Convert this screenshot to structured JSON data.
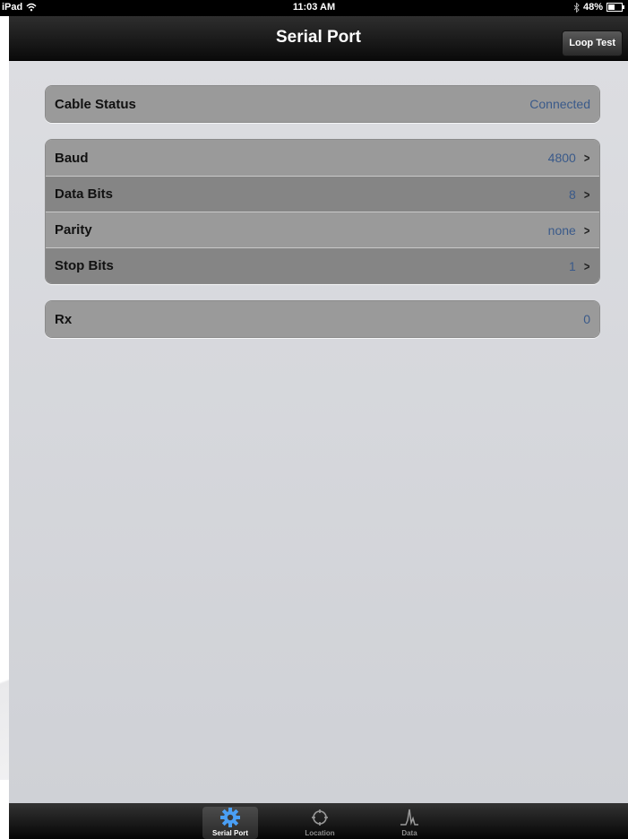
{
  "status_bar": {
    "device": "iPad",
    "time": "11:03 AM",
    "battery": "48%",
    "battery_level": 0.48
  },
  "nav": {
    "title": "Serial Port",
    "loop_test_label": "Loop Test"
  },
  "groups": [
    {
      "rows": [
        {
          "label": "Cable Status",
          "value": "Connected",
          "chevron": false
        }
      ]
    },
    {
      "rows": [
        {
          "label": "Baud",
          "value": "4800",
          "chevron": true
        },
        {
          "label": "Data Bits",
          "value": "8",
          "chevron": true
        },
        {
          "label": "Parity",
          "value": "none",
          "chevron": true
        },
        {
          "label": "Stop Bits",
          "value": "1",
          "chevron": true
        }
      ]
    },
    {
      "rows": [
        {
          "label": "Rx",
          "value": "0",
          "chevron": false
        }
      ]
    }
  ],
  "tabs": [
    {
      "label": "Serial Port",
      "icon": "gear-icon",
      "active": true
    },
    {
      "label": "Location",
      "icon": "crosshair-icon",
      "active": false
    },
    {
      "label": "Data",
      "icon": "waveform-icon",
      "active": false
    }
  ],
  "colors": {
    "value_text": "#3a5a8a",
    "gear_blue": "#4a9ff5"
  }
}
